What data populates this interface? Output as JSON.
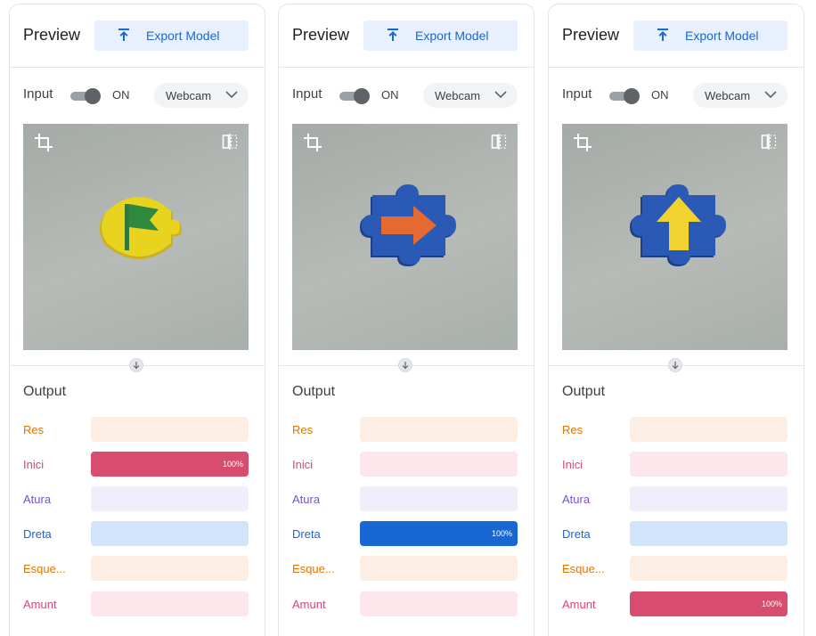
{
  "panels": [
    {
      "title": "Preview",
      "export_label": "Export Model",
      "input_label": "Input",
      "toggle_state": "ON",
      "source": "Webcam",
      "piece": "flag",
      "output_title": "Output",
      "classes": [
        {
          "name": "Res",
          "confidence": 0
        },
        {
          "name": "Inici",
          "confidence": 1,
          "label": "100%"
        },
        {
          "name": "Atura",
          "confidence": 0
        },
        {
          "name": "Dreta",
          "confidence": 0
        },
        {
          "name": "Esque...",
          "confidence": 0
        },
        {
          "name": "Amunt",
          "confidence": 0
        }
      ]
    },
    {
      "title": "Preview",
      "export_label": "Export Model",
      "input_label": "Input",
      "toggle_state": "ON",
      "source": "Webcam",
      "piece": "arrow-right",
      "output_title": "Output",
      "classes": [
        {
          "name": "Res",
          "confidence": 0
        },
        {
          "name": "Inici",
          "confidence": 0
        },
        {
          "name": "Atura",
          "confidence": 0
        },
        {
          "name": "Dreta",
          "confidence": 1,
          "label": "100%"
        },
        {
          "name": "Esque...",
          "confidence": 0
        },
        {
          "name": "Amunt",
          "confidence": 0
        }
      ]
    },
    {
      "title": "Preview",
      "export_label": "Export Model",
      "input_label": "Input",
      "toggle_state": "ON",
      "source": "Webcam",
      "piece": "arrow-up",
      "output_title": "Output",
      "classes": [
        {
          "name": "Res",
          "confidence": 0
        },
        {
          "name": "Inici",
          "confidence": 0
        },
        {
          "name": "Atura",
          "confidence": 0
        },
        {
          "name": "Dreta",
          "confidence": 0
        },
        {
          "name": "Esque...",
          "confidence": 0
        },
        {
          "name": "Amunt",
          "confidence": 1,
          "label": "100%"
        }
      ]
    }
  ],
  "class_colors": {
    "Res": {
      "text": "#e37400",
      "track": "#fdeee3",
      "fill": "#e8710a"
    },
    "Inici": {
      "text": "#d9466f",
      "track": "#fde7ec",
      "fill": "#d84c6f"
    },
    "Atura": {
      "text": "#7b4fd0",
      "track": "#f0eefc",
      "fill": "#7b4fd0"
    },
    "Dreta": {
      "text": "#1967d2",
      "track": "#d2e3fc",
      "fill": "#1967d2"
    },
    "Esque...": {
      "text": "#e37400",
      "track": "#fdeee3",
      "fill": "#e8710a"
    },
    "Amunt": {
      "text": "#d9466f",
      "track": "#fde7ec",
      "fill": "#d84c6f"
    }
  },
  "icons": {
    "export": "upload-icon",
    "chevron": "chevron-down-icon",
    "crop": "crop-icon",
    "flip": "flip-icon",
    "arrow": "arrow-down-icon"
  }
}
